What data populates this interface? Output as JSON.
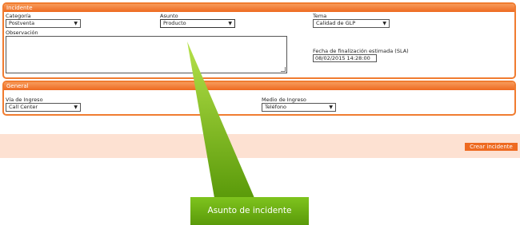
{
  "incidente": {
    "header": "Incidente",
    "categoria": {
      "label": "Categoría",
      "value": "Postventa"
    },
    "asunto": {
      "label": "Asunto",
      "value": "Producto"
    },
    "tema": {
      "label": "Tema",
      "value": "Calidad de GLP"
    },
    "observacion": {
      "label": "Observación",
      "value": ""
    },
    "sla": {
      "label": "Fecha de finalización estimada (SLA)",
      "value": "08/02/2015 14:28:00"
    }
  },
  "general": {
    "header": "General",
    "via": {
      "label": "Vía de Ingreso",
      "value": "Call Center"
    },
    "medio": {
      "label": "Medio de Ingreso",
      "value": "Teléfono"
    }
  },
  "actions": {
    "create_label": "Crear incidente"
  },
  "callout": {
    "text": "Asunto de incidente"
  },
  "colors": {
    "accent": "#ee6a20",
    "band": "#fde1d2",
    "callout": "#6bb015"
  },
  "icons": {
    "dropdown": "chevron-down-icon",
    "resize": "resize-grip-icon"
  }
}
